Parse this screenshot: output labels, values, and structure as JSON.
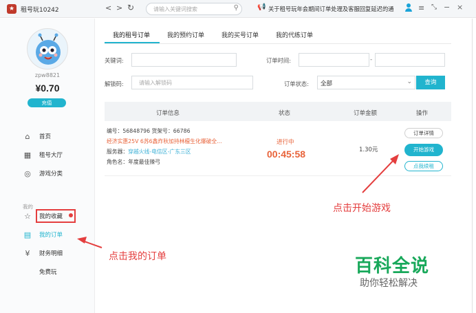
{
  "titlebar": {
    "app_title": "租号玩10242",
    "search_placeholder": "请输入关键词搜索",
    "notice": "关于租号玩年会期间订单处理及客服回复延迟的通"
  },
  "sidebar": {
    "username": "zpw8821",
    "balance": "¥0.70",
    "recharge_label": "充值",
    "items": [
      {
        "label": "首页",
        "icon": "home-icon"
      },
      {
        "label": "租号大厅",
        "icon": "shop-icon"
      },
      {
        "label": "游戏分类",
        "icon": "gamepad-icon"
      }
    ],
    "section_mine": "我的",
    "mine_items": [
      {
        "label": "我的收藏",
        "icon": "star-icon"
      },
      {
        "label": "我的订单",
        "icon": "order-icon"
      },
      {
        "label": "财务明细",
        "icon": "money-icon"
      },
      {
        "label": "免费玩"
      }
    ]
  },
  "tabs": [
    {
      "label": "我的租号订单",
      "active": true
    },
    {
      "label": "我的预约订单"
    },
    {
      "label": "我的买号订单"
    },
    {
      "label": "我的代练订单"
    }
  ],
  "filters": {
    "keyword_label": "关键词:",
    "order_time_label": "订单时间:",
    "date_sep": "-",
    "unlock_label": "解锁码:",
    "unlock_placeholder": "请输入解锁码",
    "status_label": "订单状态:",
    "status_value": "全部",
    "query_label": "查询"
  },
  "table": {
    "headers": [
      "订单信息",
      "状态",
      "订单金额",
      "操作"
    ]
  },
  "order": {
    "line1": "编号：56848796  货架号：66786",
    "line2": "经济实惠25V 6苏6鑫炸秋加持林檀生化爆破全...",
    "server_label": "服务器：",
    "server_value": "穿越火线-电信区-广东三区",
    "role_label": "角色名：",
    "role_value": "年度最佳辣弓",
    "status": "进行中",
    "countdown": "00:45:58",
    "amount": "1.30元",
    "detail_label": "订单详情",
    "start_label": "开始游戏",
    "renew_label": "点我续租"
  },
  "annotations": {
    "click_start": "点击开始游戏",
    "click_orders": "点击我的订单"
  },
  "watermark": {
    "title": "百科全说",
    "subtitle": "助你轻松解决"
  },
  "colors": {
    "accent": "#21b4ce",
    "annotation": "#e43e3e",
    "orange": "#e8633a",
    "watermark": "#18a85a"
  }
}
